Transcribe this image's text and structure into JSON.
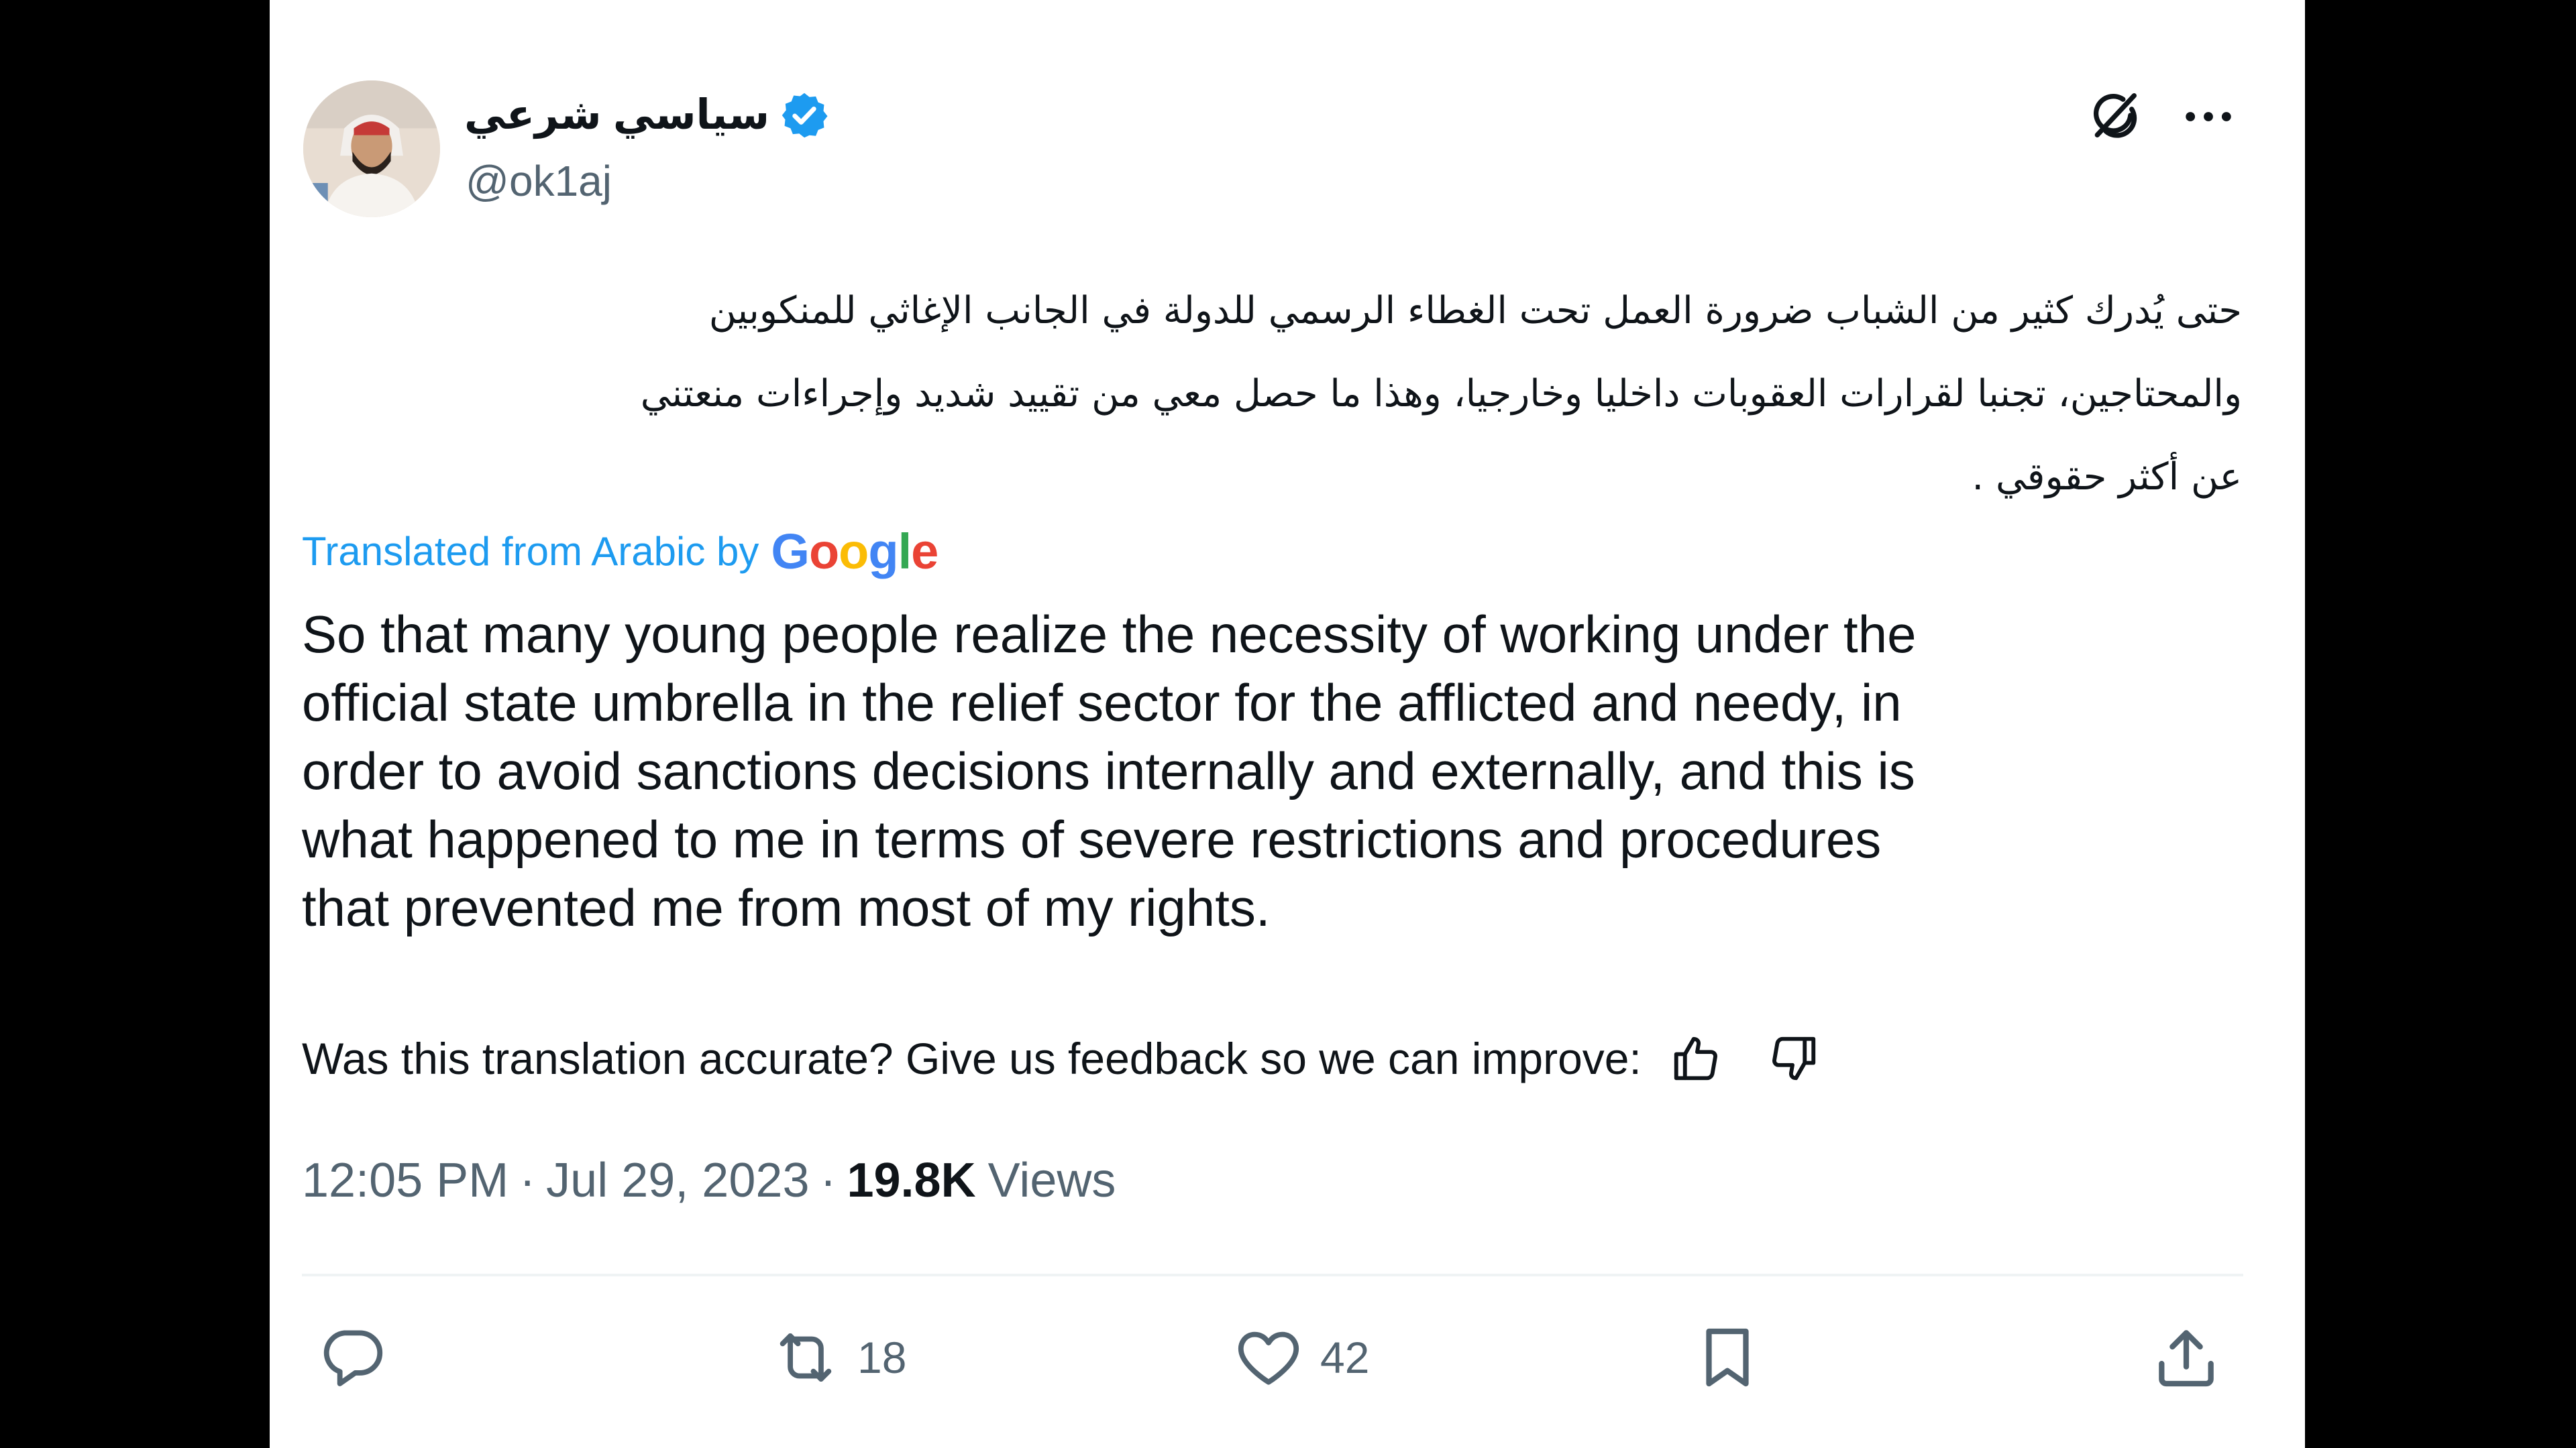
{
  "tweet": {
    "author": {
      "display_name": "سياسي شرعي",
      "handle": "@ok1aj",
      "verified": true
    },
    "header_icons": [
      "grok-icon",
      "more-icon"
    ],
    "arabic_text": "حتى يُدرك كثير من الشباب ضرورة العمل تحت الغطاء الرسمي للدولة في الجانب الإغاثي للمنكوبين\nوالمحتاجين، تجنبا لقرارات العقوبات داخليا وخارجيا، وهذا ما حصل معي من تقييد شديد وإجراءات منعتني\nعن أكثر حقوقي .",
    "translation": {
      "label": "Translated from Arabic by",
      "provider": "Google",
      "provider_letters": [
        "G",
        "o",
        "o",
        "g",
        "l",
        "e"
      ],
      "provider_colors": [
        "#4285f4",
        "#ea4335",
        "#fbbc05",
        "#4285f4",
        "#34a853",
        "#ea4335"
      ],
      "text": "So that many young people realize the necessity of working under the\nofficial state umbrella in the relief sector for the afflicted and needy, in\norder to avoid sanctions decisions internally and externally, and this is\nwhat happened to me in terms of severe restrictions and procedures\nthat prevented me from most of my rights.",
      "feedback_prompt": "Was this translation accurate? Give us feedback so we can improve:",
      "feedback_icons": [
        "thumbs-up-icon",
        "thumbs-down-icon"
      ]
    },
    "meta": {
      "time": "12:05 PM",
      "separator": "·",
      "date": "Jul 29, 2023",
      "views_count": "19.8K",
      "views_label": "Views"
    },
    "actions": {
      "reply_count": "",
      "retweet_count": "18",
      "like_count": "42"
    }
  },
  "colors": {
    "background": "#000000",
    "card": "#ffffff",
    "text": "#0f1419",
    "secondary": "#536471",
    "link": "#1d9bf0",
    "divider": "#eff3f4"
  }
}
